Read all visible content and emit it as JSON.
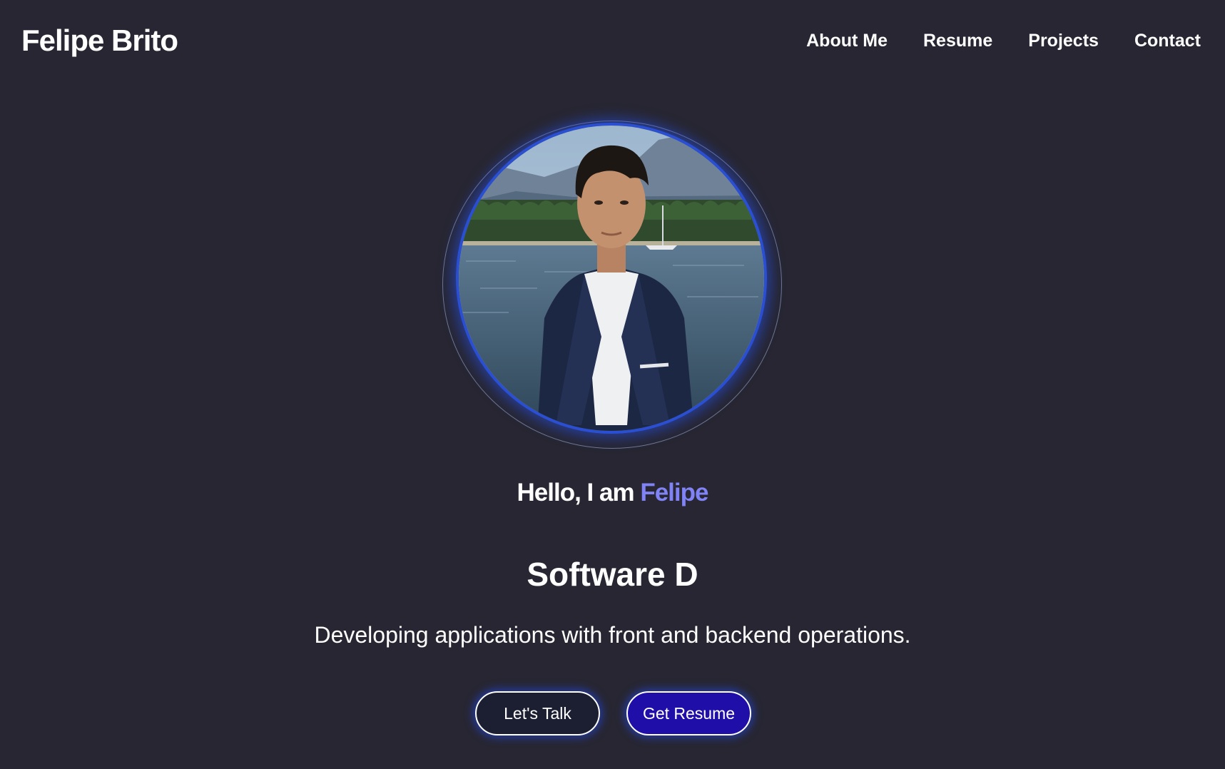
{
  "header": {
    "brand": "Felipe Brito",
    "nav": [
      {
        "label": "About Me"
      },
      {
        "label": "Resume"
      },
      {
        "label": "Projects"
      },
      {
        "label": "Contact"
      }
    ]
  },
  "hero": {
    "greeting_prefix": "Hello, I am ",
    "greeting_name": "Felipe",
    "role": "Software D",
    "tagline": "Developing applications with front and backend operations.",
    "buttons": {
      "talk": "Let's Talk",
      "resume": "Get Resume"
    }
  },
  "colors": {
    "background": "#272632",
    "accent": "#7f83f5",
    "ring": "#2a4fd3",
    "primary_button": "#200ea9",
    "secondary_button": "#1b1f31"
  }
}
